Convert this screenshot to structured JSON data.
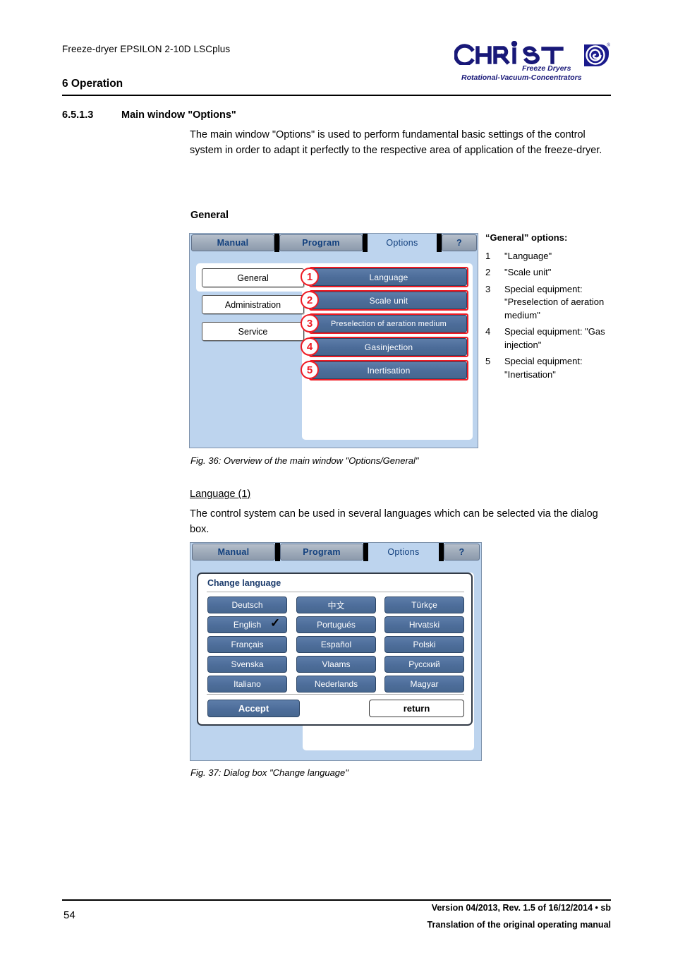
{
  "header": {
    "running_title": "Freeze-dryer EPSILON 2-10D LSCplus",
    "chapter": "6 Operation",
    "logo": {
      "wordmark": "CHRIST",
      "tagline_1": "Freeze Dryers",
      "tagline_2": "Rotational-Vacuum-Concentrators",
      "registered_mark": "®",
      "color": "#181878"
    }
  },
  "section": {
    "number": "6.5.1.3",
    "title": "Main window \"Options\"",
    "intro": "The main window \"Options\" is used to perform fundamental basic settings of the control system in order to adapt it perfectly to the respective area of application of the freeze-dryer."
  },
  "general": {
    "label": "General"
  },
  "fig36": {
    "tabs": [
      {
        "label": "Manual",
        "active": false
      },
      {
        "label": "Program",
        "active": false
      },
      {
        "label": "Options",
        "active": true
      },
      {
        "label": "?",
        "active": true
      }
    ],
    "nav_buttons": [
      {
        "label": "General",
        "active": true
      },
      {
        "label": "Administration",
        "active": false
      },
      {
        "label": "Service",
        "active": false
      }
    ],
    "option_buttons": [
      {
        "num": "1",
        "label": "Language"
      },
      {
        "num": "2",
        "label": "Scale unit"
      },
      {
        "num": "3",
        "label": "Preselection of aeration medium"
      },
      {
        "num": "4",
        "label": "Gasinjection"
      },
      {
        "num": "5",
        "label": "Inertisation"
      }
    ],
    "highlight_color": "#ee1b24",
    "caption": "Fig. 36: Overview of the main window \"Options/General\"",
    "legend": {
      "title": "“General” options:",
      "items": [
        {
          "num": "1",
          "text": "\"Language\""
        },
        {
          "num": "2",
          "text": "\"Scale unit\""
        },
        {
          "num": "3",
          "text": "Special equipment: \"Preselection of aeration medium\""
        },
        {
          "num": "4",
          "text": "Special equipment: \"Gas injection\""
        },
        {
          "num": "5",
          "text": "Special equipment: \"Inertisation\""
        }
      ]
    }
  },
  "language_section": {
    "heading": "Language (1)",
    "paragraph": "The control system can be used in several languages which can be selected via the dialog box."
  },
  "fig37": {
    "tabs": [
      {
        "label": "Manual",
        "active": false
      },
      {
        "label": "Program",
        "active": false
      },
      {
        "label": "Options",
        "active": true
      },
      {
        "label": "?",
        "active": true
      }
    ],
    "dialog_title": "Change language",
    "languages": [
      {
        "label": "Deutsch",
        "selected": false
      },
      {
        "label": "中文",
        "selected": false
      },
      {
        "label": "Türkçe",
        "selected": false
      },
      {
        "label": "English",
        "selected": true
      },
      {
        "label": "Portugués",
        "selected": false
      },
      {
        "label": "Hrvatski",
        "selected": false
      },
      {
        "label": "Français",
        "selected": false
      },
      {
        "label": "Español",
        "selected": false
      },
      {
        "label": "Polski",
        "selected": false
      },
      {
        "label": "Svenska",
        "selected": false
      },
      {
        "label": "Vlaams",
        "selected": false
      },
      {
        "label": "Русский",
        "selected": false
      },
      {
        "label": "Italiano",
        "selected": false
      },
      {
        "label": "Nederlands",
        "selected": false
      },
      {
        "label": "Magyar",
        "selected": false
      }
    ],
    "selected_check": "✓",
    "accept_label": "Accept",
    "return_label": "return",
    "caption": "Fig. 37: Dialog box \"Change language\""
  },
  "footer": {
    "page_number": "54",
    "version": "Version 04/2013, Rev. 1.5 of 16/12/2014 • sb",
    "translation": "Translation of the original operating manual"
  }
}
